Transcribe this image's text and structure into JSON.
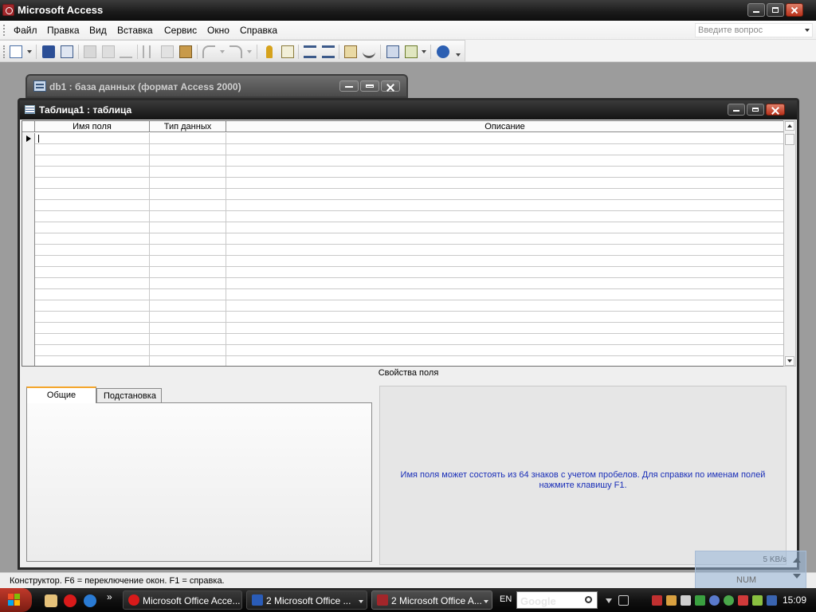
{
  "app": {
    "title": "Microsoft Access",
    "menu": [
      {
        "label": "Файл"
      },
      {
        "label": "Правка"
      },
      {
        "label": "Вид"
      },
      {
        "label": "Вставка"
      },
      {
        "label": "Сервис"
      },
      {
        "label": "Окно"
      },
      {
        "label": "Справка"
      }
    ],
    "ask_placeholder": "Введите вопрос"
  },
  "toolbar": {
    "icons": [
      "view-icon",
      "save-icon",
      "search-icon",
      "print-icon",
      "print-preview-icon",
      "spelling-icon",
      "cut-icon",
      "copy-icon",
      "paste-icon",
      "undo-icon",
      "redo-icon",
      "primary-key-icon",
      "indexes-icon",
      "insert-rows-icon",
      "delete-rows-icon",
      "properties-icon",
      "build-icon",
      "database-window-icon",
      "new-object-icon",
      "help-icon"
    ]
  },
  "db_window": {
    "title": "db1 : база данных (формат Access 2000)"
  },
  "table_window": {
    "title": "Таблица1 : таблица",
    "columns": [
      "Имя поля",
      "Тип данных",
      "Описание"
    ],
    "field_properties_label": "Свойства поля",
    "tabs": [
      {
        "label": "Общие",
        "active": true
      },
      {
        "label": "Подстановка",
        "active": false
      }
    ],
    "help_text": "Имя поля может состоять из 64 знаков с учетом пробелов.  Для справки по именам полей нажмите клавишу F1."
  },
  "status": {
    "text": "Конструктор.  F6 = переключение окон.  F1 = справка.",
    "num": "NUM",
    "net_speed": "5 KB/s"
  },
  "taskbar": {
    "buttons": [
      {
        "label": "Microsoft Office Acce...",
        "active": false
      },
      {
        "label": "2 Microsoft Office ...",
        "active": false
      },
      {
        "label": "2 Microsoft Office A...",
        "active": true
      }
    ],
    "lang": "EN",
    "search_placeholder": "Google",
    "clock": "15:09"
  },
  "colors": {
    "help_text": "#1a2fb8",
    "title_bar": "#1a1a1a",
    "tab_accent": "#f4a52a"
  }
}
